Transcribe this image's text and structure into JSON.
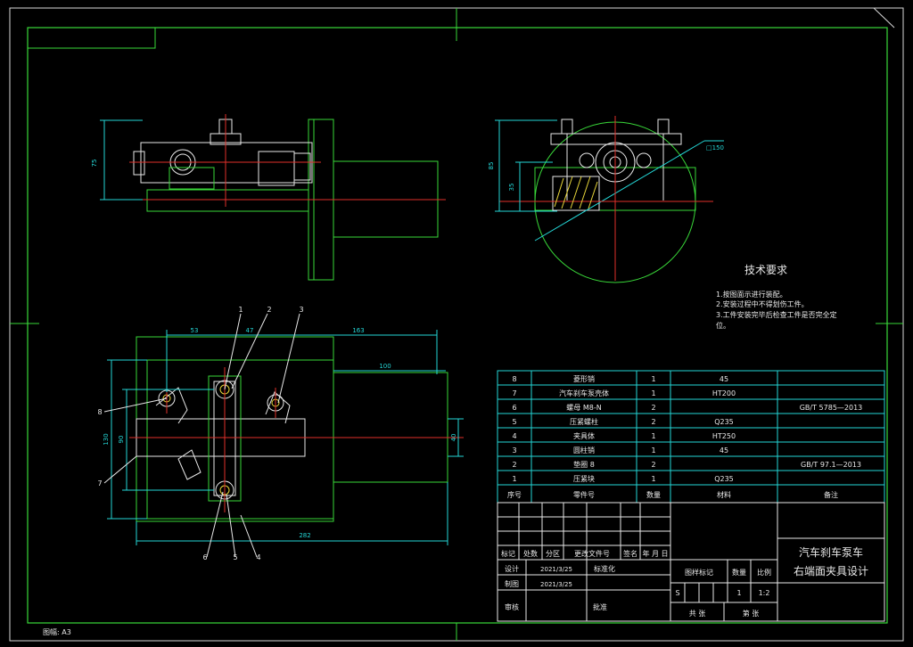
{
  "sheet": {
    "paper_size_label": "图幅: A3"
  },
  "technical_requirements": {
    "title": "技术要求",
    "items": [
      "1.按图面示进行装配。",
      "2.安装过程中不得划伤工件。",
      "3.工件安装完毕后检查工件是否完全定",
      "位。"
    ]
  },
  "top_left_view": {
    "dim_height": "75"
  },
  "right_view": {
    "dim_outer": "85",
    "dim_inner": "35",
    "dim_diameter": "□150"
  },
  "plan_view": {
    "dim_53": "53",
    "dim_47": "47",
    "dim_163": "163",
    "dim_100": "100",
    "dim_282": "282",
    "dim_130": "130",
    "dim_90": "90",
    "dim_40": "40",
    "balloons_top": [
      "1",
      "2",
      "3"
    ],
    "balloons_left": [
      "8",
      "7"
    ],
    "balloons_bottom": [
      "6",
      "5",
      "4"
    ]
  },
  "bom": {
    "rows": [
      {
        "no": "8",
        "name": "菱形销",
        "qty": "1",
        "material": "45",
        "note": ""
      },
      {
        "no": "7",
        "name": "汽车刹车泵壳体",
        "qty": "1",
        "material": "HT200",
        "note": ""
      },
      {
        "no": "6",
        "name": "螺母 M8-N",
        "qty": "2",
        "material": "",
        "note": "GB/T 5785—2013"
      },
      {
        "no": "5",
        "name": "压紧螺柱",
        "qty": "2",
        "material": "Q235",
        "note": ""
      },
      {
        "no": "4",
        "name": "夹具体",
        "qty": "1",
        "material": "HT250",
        "note": ""
      },
      {
        "no": "3",
        "name": "圆柱销",
        "qty": "1",
        "material": "45",
        "note": ""
      },
      {
        "no": "2",
        "name": "垫圈 8",
        "qty": "2",
        "material": "",
        "note": "GB/T 97.1—2013"
      },
      {
        "no": "1",
        "name": "压紧块",
        "qty": "1",
        "material": "Q235",
        "note": ""
      }
    ],
    "header": {
      "no": "序号",
      "name": "零件号",
      "qty": "数量",
      "material": "材料",
      "note": "备注"
    }
  },
  "title_block": {
    "rev_header": [
      "标记",
      "处数",
      "分区",
      "更改文件号",
      "签名",
      "年 月 日"
    ],
    "design_label": "设计",
    "design_date": "2021/3/25",
    "standard_label": "标准化",
    "draw_label": "制图",
    "draw_date": "2021/3/25",
    "review_label": "审核",
    "approve_label": "批准",
    "stage_header": [
      "图样标记",
      "数量",
      "比例"
    ],
    "stage_mark": "S",
    "quantity": "1",
    "scale": "1:2",
    "sheets_total": "共  张",
    "sheet_no": "第  张",
    "drawing_title_1": "汽车刹车泵车",
    "drawing_title_2": "右端面夹具设计"
  },
  "colors": {
    "background": "#000000",
    "frame": "#39d839",
    "outline": "#39d839",
    "center_line": "#e0302a",
    "dimension": "#24d6d6",
    "part": "#e8e8e8",
    "hatch": "#e8d73a"
  }
}
